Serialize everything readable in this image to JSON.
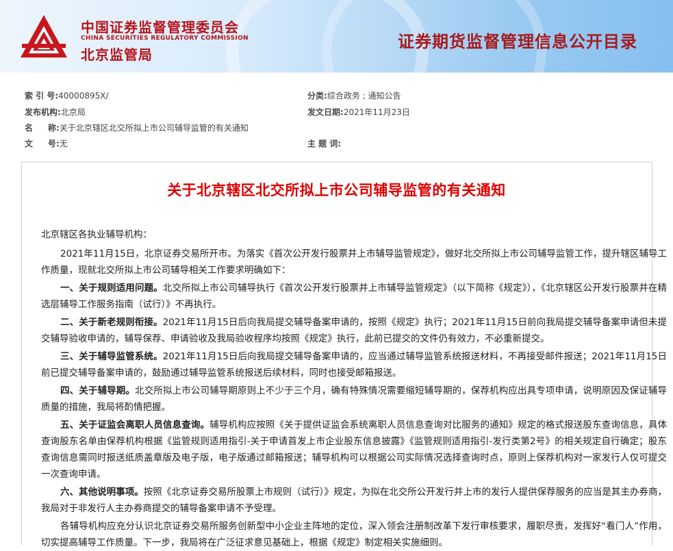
{
  "header": {
    "org_cn": "中国证券监督管理委员会",
    "org_en": "CHINA SECURITIES REGULATORY COMMISSION",
    "org_sub": "北京监管局",
    "site_title": "证券期货监督管理信息公开目录",
    "logo_icon": "csrc-logo-icon",
    "brand_color": "#b8151b"
  },
  "meta": {
    "index_label": "索 引 号:",
    "index_value": "40000895X/",
    "category_label": "分类:",
    "category_value": "综合政务 ; 通知公告",
    "issuer_label": "发布机构:",
    "issuer_value": "北京局",
    "date_label": "发文日期:",
    "date_value": "2021年11月23日",
    "name_label_a": "名",
    "name_label_b": "称:",
    "name_value": "关于北京辖区北交所拟上市公司辅导监管的有关通知",
    "docno_label_a": "文",
    "docno_label_b": "号:",
    "docno_value": "无",
    "keywords_label": "主 题 词:",
    "keywords_value": ""
  },
  "document": {
    "title": "关于北京辖区北交所拟上市公司辅导监管的有关通知",
    "title_color": "#e00000",
    "salutation": "北京辖区各执业辅导机构：",
    "intro": "2021年11月15日，北京证券交易所开市。为落实《首次公开发行股票并上市辅导监管规定》，做好北交所拟上市公司辅导监管工作，提升辖区辅导工作质量，现就北交所拟上市公司辅导相关工作要求明确如下：",
    "items": [
      {
        "head": "一、关于规则适用问题。",
        "text": "北交所拟上市公司辅导执行《首次公开发行股票并上市辅导监管规定》（以下简称《规定》），《北京辖区公开发行股票并在精选层辅导工作服务指南（试行）》不再执行。"
      },
      {
        "head": "二、关于新老规则衔接。",
        "text": "2021年11月15日后向我局提交辅导备案申请的，按照《规定》执行；2021年11月15日前向我局提交辅导备案申请但未提交辅导验收申请的，辅导保荐、申请验收及我局验收程序均按照《规定》执行，此前已提交的文件仍有效力，不必重新提交。"
      },
      {
        "head": "三、关于辅导监管系统。",
        "text": "2021年11月15日后向我局提交辅导备案申请的，应当通过辅导监管系统报送材料，不再接受邮件报送；2021年11月15日前已提交辅导备案申请的，鼓励通过辅导监管系统报送后续材料，同时也接受邮箱报送。"
      },
      {
        "head": "四、关于辅导期。",
        "text": "北交所拟上市公司辅导期原则上不少于三个月，确有特殊情况需要缩短辅导期的，保荐机构应出具专项申请，说明原因及保证辅导质量的措施，我局将酌情把握。"
      },
      {
        "head": "五、关于证监会离职人员信息查询。",
        "text": "辅导机构应按照《关于提供证监会系统离职人员信息查询对比服务的通知》规定的格式报送股东查询信息，具体查询股东名单由保荐机构根据《监管规则适用指引-关于申请首发上市企业股东信息披露》《监管规则适用指引-发行类第2号》的相关规定自行确定；股东查询信息需同时报送纸质盖章版及电子版，电子版通过邮箱报送；辅导机构可以根据公司实际情况选择查询时点，原则上保荐机构对一家发行人仅可提交一次查询申请。"
      },
      {
        "head": "六、其他说明事项。",
        "text": "按照《北京证券交易所股票上市规则（试行）》规定，为拟在北交所公开发行并上市的发行人提供保荐服务的应当是其主办券商，我局对于非发行人主办券商提交的辅导备案申请不予受理。"
      }
    ],
    "closing": "各辅导机构应充分认识北京证券交易所服务创新型中小企业主阵地的定位，深入领会注册制改革下发行审核要求，履职尽责，发挥好“看门人”作用，切实提高辅导工作质量。下一步，我局将在广泛征求意见基础上，根据《规定》制定相关实施细则。"
  }
}
